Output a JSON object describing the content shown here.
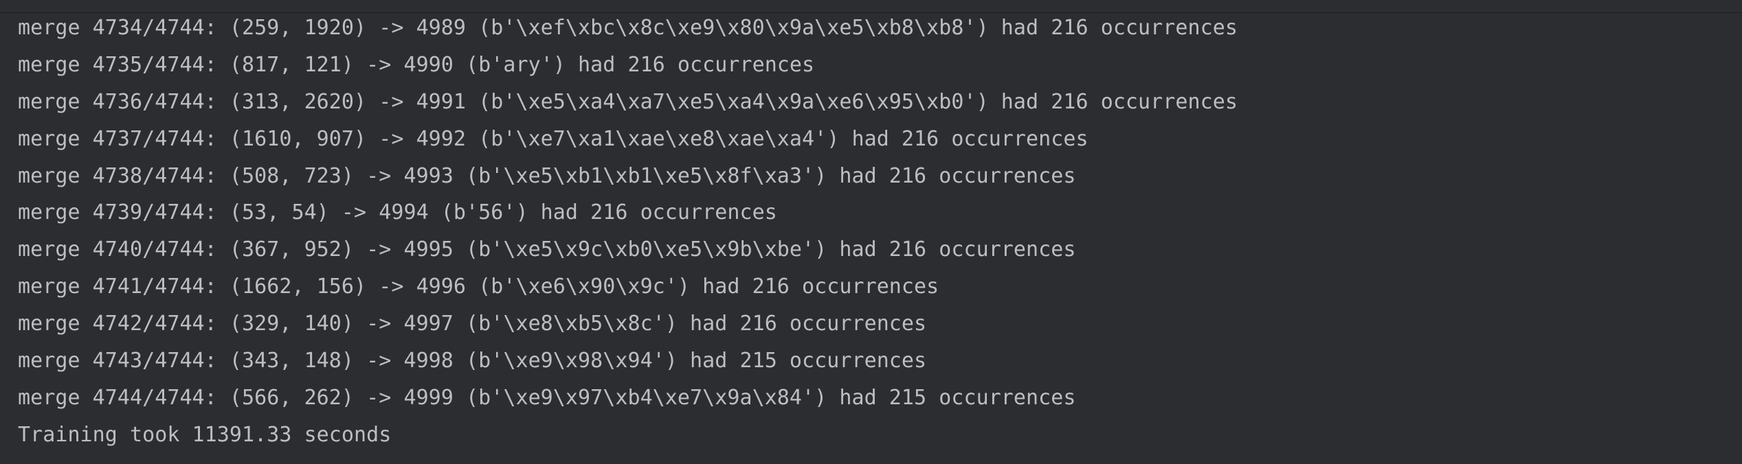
{
  "console": {
    "lines": [
      "merge 4734/4744: (259, 1920) -> 4989 (b'\\xef\\xbc\\x8c\\xe9\\x80\\x9a\\xe5\\xb8\\xb8') had 216 occurrences",
      "merge 4735/4744: (817, 121) -> 4990 (b'ary') had 216 occurrences",
      "merge 4736/4744: (313, 2620) -> 4991 (b'\\xe5\\xa4\\xa7\\xe5\\xa4\\x9a\\xe6\\x95\\xb0') had 216 occurrences",
      "merge 4737/4744: (1610, 907) -> 4992 (b'\\xe7\\xa1\\xae\\xe8\\xae\\xa4') had 216 occurrences",
      "merge 4738/4744: (508, 723) -> 4993 (b'\\xe5\\xb1\\xb1\\xe5\\x8f\\xa3') had 216 occurrences",
      "merge 4739/4744: (53, 54) -> 4994 (b'56') had 216 occurrences",
      "merge 4740/4744: (367, 952) -> 4995 (b'\\xe5\\x9c\\xb0\\xe5\\x9b\\xbe') had 216 occurrences",
      "merge 4741/4744: (1662, 156) -> 4996 (b'\\xe6\\x90\\x9c') had 216 occurrences",
      "merge 4742/4744: (329, 140) -> 4997 (b'\\xe8\\xb5\\x8c') had 216 occurrences",
      "merge 4743/4744: (343, 148) -> 4998 (b'\\xe9\\x98\\x94') had 215 occurrences",
      "merge 4744/4744: (566, 262) -> 4999 (b'\\xe9\\x97\\xb4\\xe7\\x9a\\x84') had 215 occurrences",
      "Training took 11391.33 seconds"
    ]
  },
  "colors": {
    "background": "#2b2d30",
    "text": "#bcbec4"
  }
}
